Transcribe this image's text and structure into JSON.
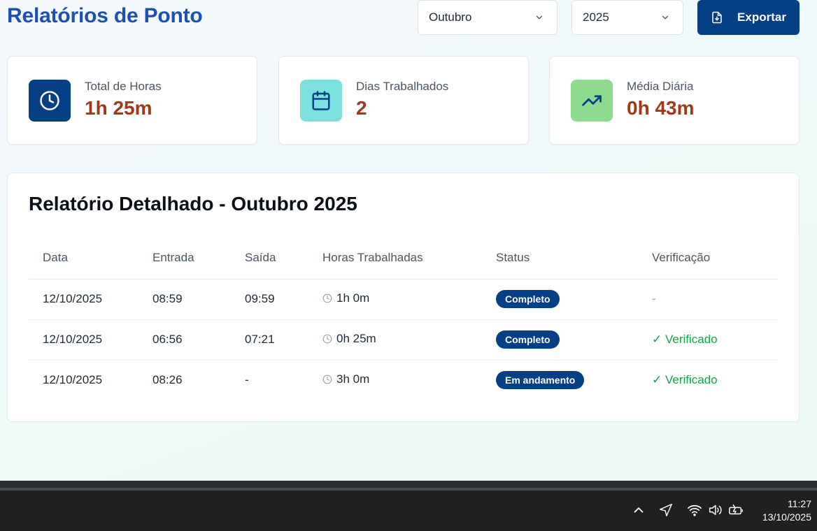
{
  "header": {
    "title": "Relatórios de Ponto",
    "month_select": "Outubro",
    "year_select": "2025",
    "export_label": "Exportar"
  },
  "stats": [
    {
      "label": "Total de Horas",
      "value": "1h 25m",
      "icon": "clock-icon",
      "icon_bg": "#053f86"
    },
    {
      "label": "Dias Trabalhados",
      "value": "2",
      "icon": "calendar-icon",
      "icon_bg": "#7de0e0"
    },
    {
      "label": "Média Diária",
      "value": "0h 43m",
      "icon": "trending-up-icon",
      "icon_bg": "#8ddc8d"
    }
  ],
  "report": {
    "title": "Relatório Detalhado - Outubro 2025",
    "columns": [
      "Data",
      "Entrada",
      "Saída",
      "Horas Trabalhadas",
      "Status",
      "Verificação"
    ],
    "rows": [
      {
        "date": "12/10/2025",
        "in": "08:59",
        "out": "09:59",
        "hours": "1h 0m",
        "status": "Completo",
        "verification": "-"
      },
      {
        "date": "12/10/2025",
        "in": "06:56",
        "out": "07:21",
        "hours": "0h 25m",
        "status": "Completo",
        "verification": "✓ Verificado"
      },
      {
        "date": "12/10/2025",
        "in": "08:26",
        "out": "-",
        "hours": "3h 0m",
        "status": "Em andamento",
        "verification": "✓ Verificado"
      }
    ]
  },
  "taskbar": {
    "time": "11:27",
    "date": "13/10/2025"
  },
  "colors": {
    "brand": "#053f86",
    "title": "#1e4fb2",
    "stat_value": "#a0391a",
    "verified": "#16a34a"
  }
}
